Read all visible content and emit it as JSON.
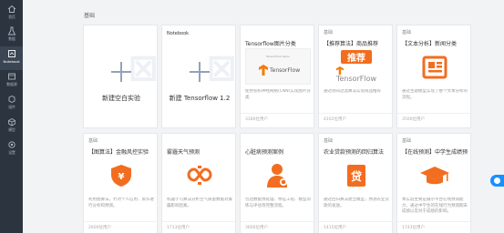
{
  "sidebar": {
    "items": [
      {
        "label": "首页",
        "icon": "home-icon"
      },
      {
        "label": "数据",
        "icon": "experiment-icon"
      },
      {
        "label": "Notebook",
        "icon": "notebook-icon"
      },
      {
        "label": "数据源",
        "icon": "database-icon"
      },
      {
        "label": "组件",
        "icon": "component-icon"
      },
      {
        "label": "模型",
        "icon": "model-icon"
      },
      {
        "label": "设置",
        "icon": "settings-icon"
      }
    ],
    "active_index": 2
  },
  "main": {
    "section_label": "基础",
    "cards_row1": [
      {
        "type": "new",
        "label": "新建空白实验",
        "top": ""
      },
      {
        "type": "new",
        "label": "新建 Tensorflow 1.2",
        "top": "Notebook"
      },
      {
        "type": "content",
        "tag": "",
        "title": "Tensorflow图片分类",
        "desc": "使用卷积神经网络(CNN)实现图片分类",
        "users": "3180位用户",
        "thumb_small": "TensorFlow demo",
        "thumb_word": "TensorFlow"
      },
      {
        "type": "content",
        "tag": "基础",
        "title": "【推荐算法】商品推荐",
        "desc": "通过协同过滤算法实现商品推荐",
        "users": "4102位用户",
        "btn": "推荐",
        "tf_word": "TensorFlow"
      },
      {
        "type": "content",
        "tag": "基础",
        "title": "【文本分析】新闻分类",
        "desc": "通过主题模型实现了整个文本分析的流程。",
        "users": "3500位用户"
      }
    ],
    "cards_row2": [
      {
        "tag": "基础",
        "title": "【图算法】金融风控实验",
        "desc": "利用图算法，针对个人信用、欺诈进行分析和预测。",
        "users": "2600位用户"
      },
      {
        "tag": "",
        "title": "雾霾天气预测",
        "desc": "机器学习算法分析空气质量数据对雾霾影响因素。",
        "users": "1713位用户"
      },
      {
        "tag": "",
        "title": "心脏病预测案例",
        "desc": "包括数据预处理、特征工程、模型训练与评估等完整流程。",
        "users": "3606位用户"
      },
      {
        "tag": "基础",
        "title": "农业贷款预测的回归算法",
        "desc": "通过回归算法建立模型，预测农业贷款的发放。",
        "users": "1415位用户"
      },
      {
        "tag": "基础",
        "title": "【在线预测】中学生成绩预",
        "desc": "本实验主要是展示平台在线预测能力，通过中学生的在线行为预测期末成绩以及对于成绩的影响。",
        "users": "1743位用户"
      }
    ]
  },
  "colors": {
    "sidebar_bg": "#2c3440",
    "accent": "#f26d1f",
    "toggle": "#1890ff"
  }
}
